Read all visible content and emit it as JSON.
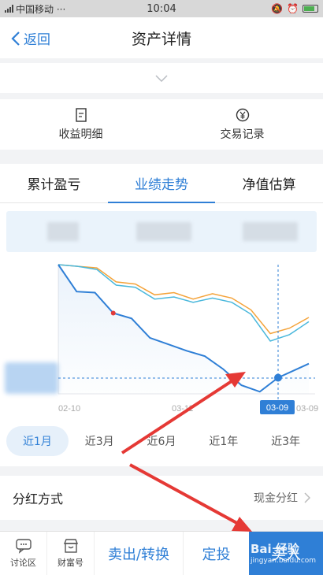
{
  "status_bar": {
    "carrier": "中国移动 ···",
    "time": "10:04"
  },
  "header": {
    "back_label": "返回",
    "title": "资产详情"
  },
  "quick_links": [
    {
      "label": "收益明细",
      "icon": "document-icon"
    },
    {
      "label": "交易记录",
      "icon": "yen-coin-icon"
    }
  ],
  "tabs": [
    {
      "label": "累计盈亏",
      "active": false
    },
    {
      "label": "业绩走势",
      "active": true
    },
    {
      "label": "净值估算",
      "active": false
    }
  ],
  "chart_data": {
    "type": "line",
    "x_tick_labels": [
      "02-10",
      "03-11",
      "03-09"
    ],
    "highlight_label": "03-09",
    "series": [
      {
        "color": "#f4a33a",
        "values": [
          0.0,
          -0.3,
          -0.6,
          -3.2,
          -3.6,
          -5.6,
          -5.2,
          -6.4,
          -5.4,
          -6.2,
          -8.4,
          -12.8,
          -11.8,
          -9.8
        ]
      },
      {
        "color": "#4ab8dc",
        "values": [
          0.0,
          -0.3,
          -0.9,
          -3.8,
          -4.2,
          -6.4,
          -6.0,
          -7.0,
          -6.2,
          -7.0,
          -9.2,
          -14.2,
          -13.0,
          -10.6
        ]
      },
      {
        "color": "#2f7fd6",
        "values": [
          0.0,
          -5.0,
          -5.2,
          -9.0,
          -10.0,
          -13.6,
          -14.8,
          -16.0,
          -17.0,
          -19.4,
          -22.4,
          -23.6,
          -21.0
        ]
      }
    ],
    "marker_color": "#e23b3b"
  },
  "ranges": [
    {
      "label": "近1月",
      "active": true
    },
    {
      "label": "近3月",
      "active": false
    },
    {
      "label": "近6月",
      "active": false
    },
    {
      "label": "近1年",
      "active": false
    },
    {
      "label": "近3年",
      "active": false
    }
  ],
  "dividend": {
    "label": "分红方式",
    "value": "现金分红"
  },
  "bottom_bar": {
    "forum_label": "讨论区",
    "wealth_label": "财富号",
    "sell_label": "卖出/转换",
    "fixed_label": "定投",
    "buy_label": "买入"
  },
  "watermark": {
    "text": "Bai 经验",
    "sub": "jingyan.baidu.com"
  },
  "colors": {
    "accent": "#2f7fd6",
    "arrow": "#e53935"
  }
}
